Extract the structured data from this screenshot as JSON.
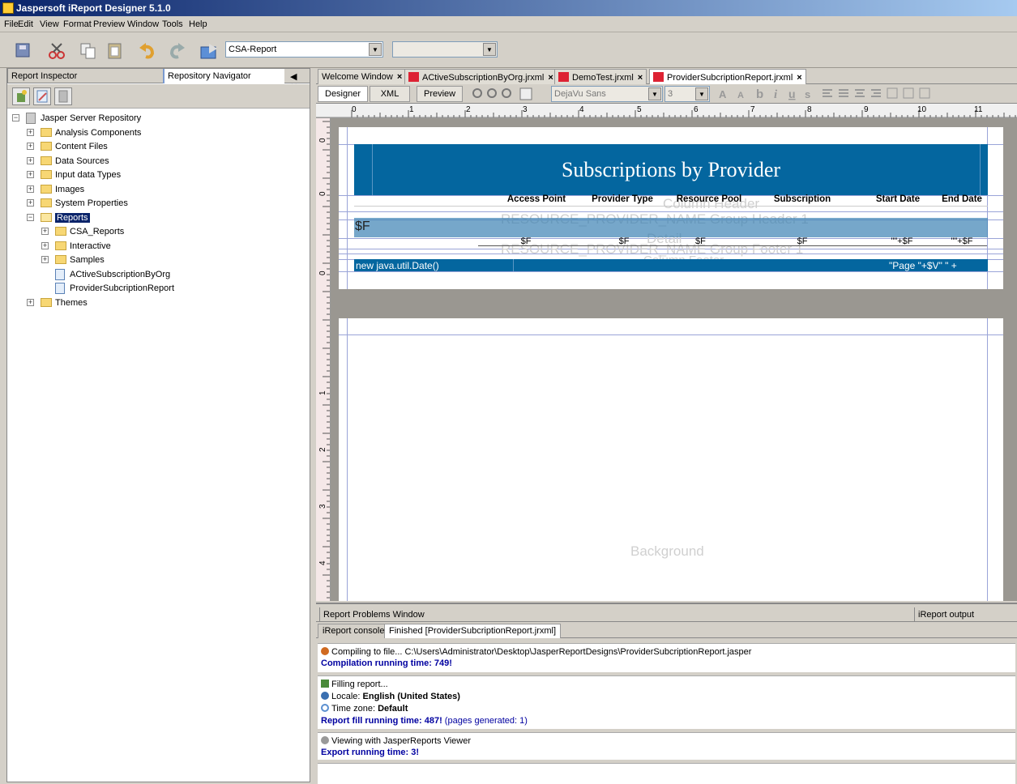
{
  "window": {
    "title": "Jaspersoft iReport Designer 5.1.0"
  },
  "menu": [
    "File",
    "Edit",
    "View",
    "Format",
    "Preview",
    "Window",
    "Tools",
    "Help"
  ],
  "toolbar": {
    "report_combo": "CSA-Report",
    "second_combo": ""
  },
  "left_panel": {
    "tabs": [
      "Report Inspector",
      "Repository Navigator"
    ],
    "tree": [
      {
        "label": "Jasper Server Repository",
        "level": 0,
        "kind": "server",
        "expanded": true
      },
      {
        "label": "Analysis Components",
        "level": 1,
        "kind": "folder"
      },
      {
        "label": "Content Files",
        "level": 1,
        "kind": "folder"
      },
      {
        "label": "Data Sources",
        "level": 1,
        "kind": "folder"
      },
      {
        "label": "Input data Types",
        "level": 1,
        "kind": "folder"
      },
      {
        "label": "Images",
        "level": 1,
        "kind": "folder"
      },
      {
        "label": "System Properties",
        "level": 1,
        "kind": "folder"
      },
      {
        "label": "Reports",
        "level": 1,
        "kind": "folder",
        "expanded": true,
        "selected": true
      },
      {
        "label": "CSA_Reports",
        "level": 2,
        "kind": "folder"
      },
      {
        "label": "Interactive",
        "level": 2,
        "kind": "folder"
      },
      {
        "label": "Samples",
        "level": 2,
        "kind": "folder"
      },
      {
        "label": "ACtiveSubscriptionByOrg",
        "level": 2,
        "kind": "report"
      },
      {
        "label": "ProviderSubcriptionReport",
        "level": 2,
        "kind": "report"
      },
      {
        "label": "Themes",
        "level": 1,
        "kind": "folder"
      }
    ]
  },
  "doc_tabs": [
    {
      "label": "Welcome Window",
      "icon": false
    },
    {
      "label": "ACtiveSubscriptionByOrg.jrxml",
      "icon": true
    },
    {
      "label": "DemoTest.jrxml",
      "icon": true
    },
    {
      "label": "ProviderSubcriptionReport.jrxml",
      "icon": true,
      "active": true
    }
  ],
  "editor_toolbar": {
    "views": [
      "Designer",
      "XML",
      "Preview"
    ],
    "font_name": "DejaVu Sans",
    "font_size": "3"
  },
  "ruler_labels": [
    "0",
    "1",
    "2",
    "3",
    "4",
    "5",
    "6",
    "7",
    "8",
    "9",
    "10",
    "11"
  ],
  "vruler_labels": [
    "0",
    "0",
    "0",
    "1",
    "2",
    "3",
    "4"
  ],
  "report": {
    "title": "Subscriptions by Provider",
    "columns": [
      "Access Point",
      "Provider Type",
      "Resource Pool",
      "Subscription",
      "Start Date",
      "End Date"
    ],
    "group_field": "$F",
    "detail_fields": [
      "$F",
      "$F",
      "$F",
      "$F",
      "\"\"+$F",
      "\"\"+$F"
    ],
    "ghost_column_header": "Column Header",
    "ghost_group_header": "RESOURCE_PROVIDER_NAME Group Header 1",
    "ghost_detail": "Detail",
    "ghost_group_footer": "RESOURCE_PROVIDER_NAME Group Footer 1",
    "ghost_column_footer": "Column Footer",
    "footer_date": "new java.util.Date()",
    "footer_page": "\"Page \"+$V\" \" +",
    "background_label": "Background"
  },
  "bottom": {
    "tabs": [
      "Report Problems Window",
      "iReport output"
    ],
    "console_tabs": [
      "iReport console",
      "Finished [ProviderSubcriptionReport.jrxml]"
    ],
    "compile_line": "Compiling to file... C:\\Users\\Administrator\\Desktop\\JasperReportDesigns\\ProviderSubcriptionReport.jasper",
    "compile_time": "Compilation running time: 749!",
    "filling": "Filling report...",
    "locale_label": "Locale:",
    "locale_value": "English (United States)",
    "timezone_label": "Time zone:",
    "timezone_value": "Default",
    "fill_time": "Report fill running time: 487!",
    "pages_generated": "(pages generated: 1)",
    "viewing": "Viewing with JasperReports Viewer",
    "export_time": "Export running time: 3!"
  }
}
